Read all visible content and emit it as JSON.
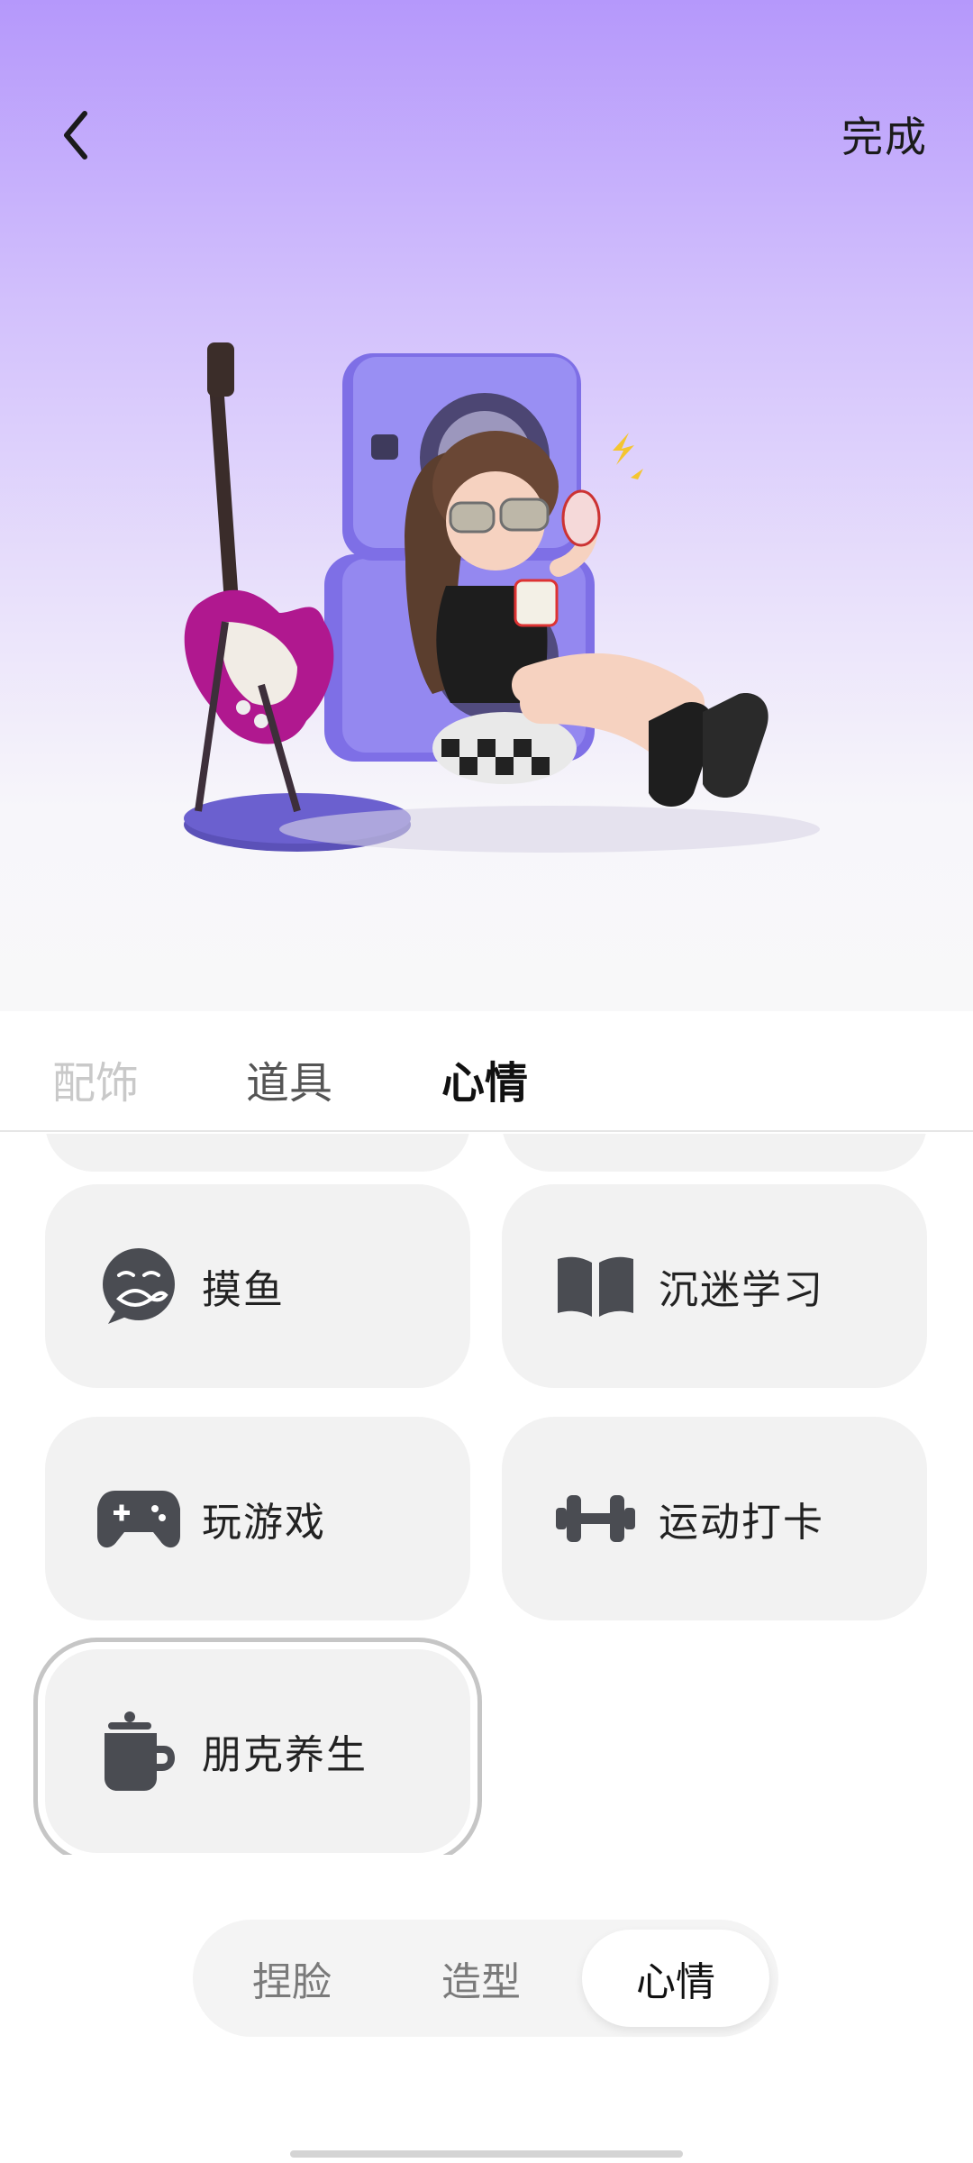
{
  "header": {
    "back_icon": "chevron-left-icon",
    "done_label": "完成"
  },
  "tabs": [
    {
      "label": "配饰",
      "state": "faded"
    },
    {
      "label": "道具",
      "state": "normal"
    },
    {
      "label": "心情",
      "state": "active"
    }
  ],
  "moods": [
    {
      "label": "摸鱼",
      "icon": "fish-face-icon"
    },
    {
      "label": "沉迷学习",
      "icon": "open-book-icon"
    },
    {
      "label": "玩游戏",
      "icon": "gamepad-icon"
    },
    {
      "label": "运动打卡",
      "icon": "dumbbell-icon"
    },
    {
      "label": "朋克养生",
      "icon": "mug-icon",
      "selected": true
    }
  ],
  "bottom_nav": {
    "items": [
      "捏脸",
      "造型",
      "心情"
    ],
    "active": "心情"
  },
  "colors": {
    "gradient_top": "#b598fb",
    "gradient_bottom": "#f8f8f9",
    "card_bg": "#f2f2f2",
    "icon": "#4a4c52",
    "selected_outline": "#c6c6c6"
  }
}
